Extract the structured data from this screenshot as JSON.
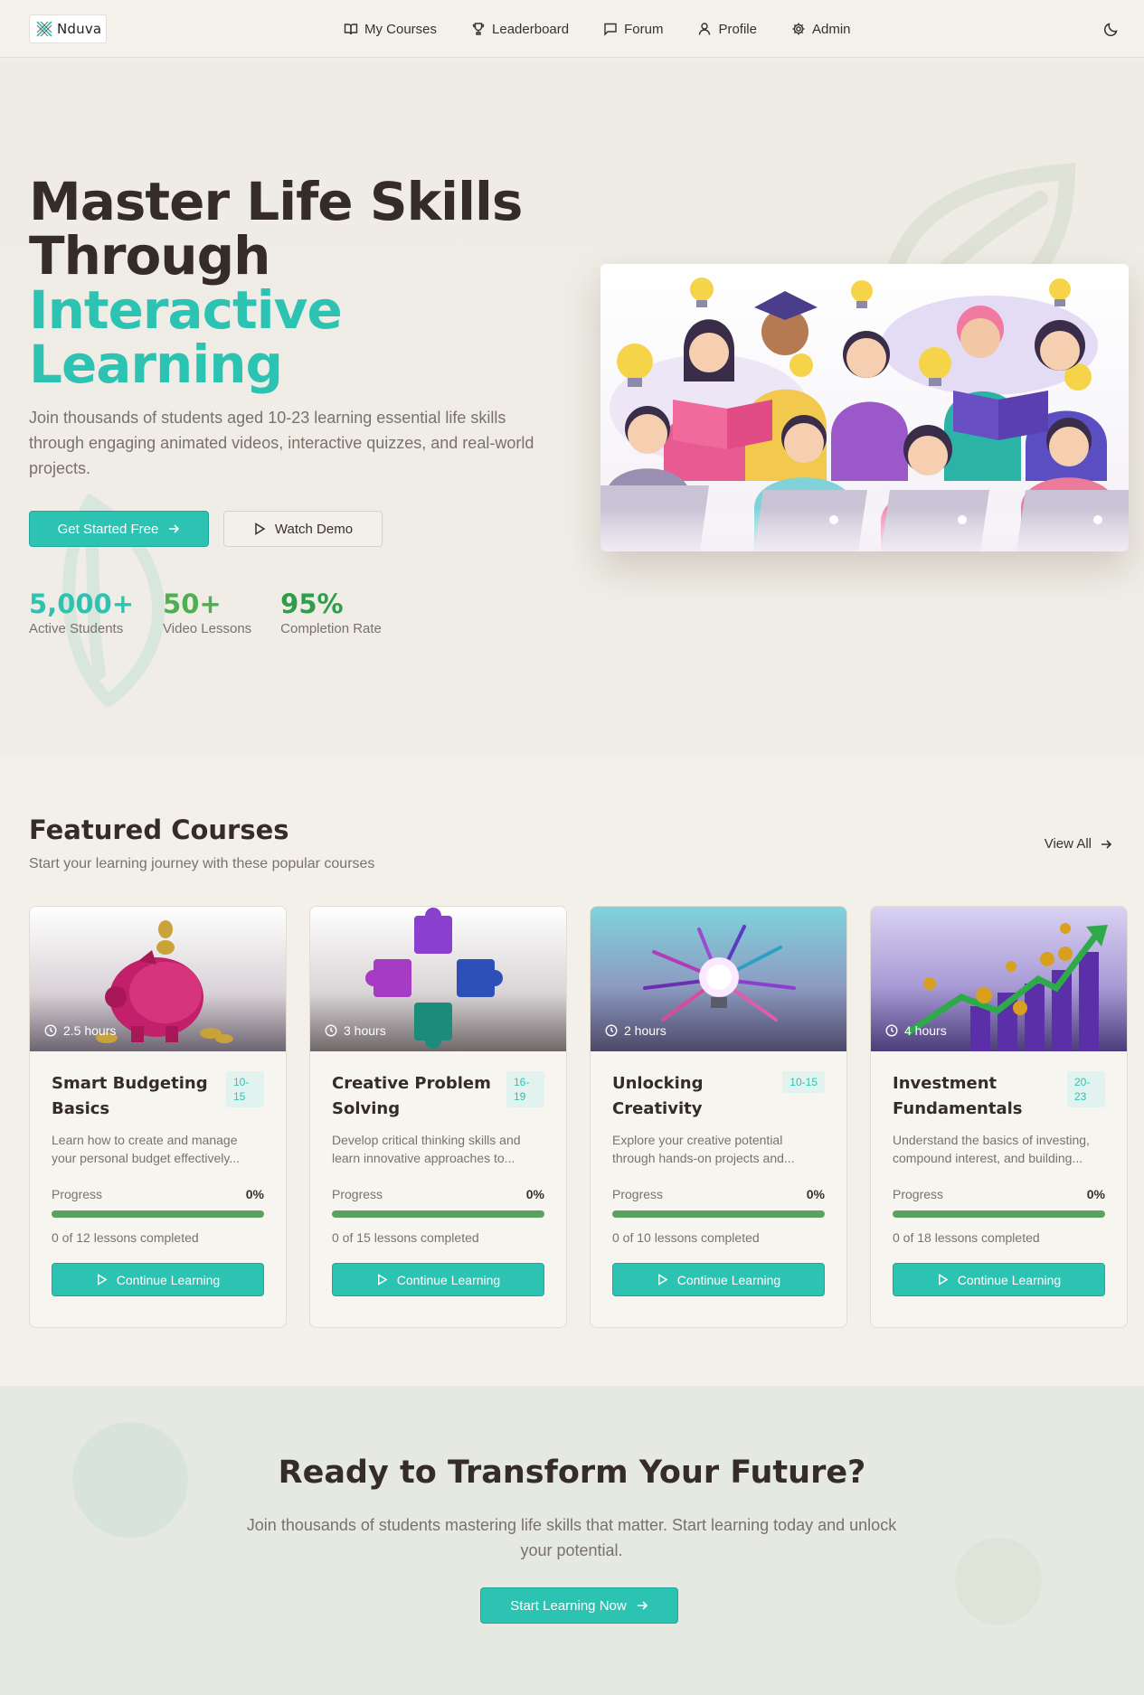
{
  "nav": {
    "logo_text": "Nduva",
    "links": [
      {
        "label": "My Courses",
        "icon": "book-icon"
      },
      {
        "label": "Leaderboard",
        "icon": "trophy-icon"
      },
      {
        "label": "Forum",
        "icon": "message-icon"
      },
      {
        "label": "Profile",
        "icon": "user-icon"
      },
      {
        "label": "Admin",
        "icon": "gear-icon"
      }
    ],
    "theme_icon": "moon-icon"
  },
  "hero": {
    "title_line1": "Master Life Skills",
    "title_line2": "Through",
    "title_accent1": "Interactive",
    "title_accent2": "Learning",
    "subtitle": "Join thousands of students aged 10-23 learning essential life skills through engaging animated videos, interactive quizzes, and real-world projects.",
    "primary_button": "Get Started Free",
    "secondary_button": "Watch Demo",
    "stats": [
      {
        "value": "5,000+",
        "label": "Active Students",
        "color": "#2cc3b3"
      },
      {
        "value": "50+",
        "label": "Video Lessons",
        "color": "#4caf50"
      },
      {
        "value": "95%",
        "label": "Completion Rate",
        "color": "#2e9e4a"
      }
    ]
  },
  "featured": {
    "title": "Featured Courses",
    "subtitle": "Start your learning journey with these popular courses",
    "view_all": "View All",
    "courses": [
      {
        "duration": "2.5 hours",
        "title": "Smart Budgeting Basics",
        "age": "10-15",
        "description": "Learn how to create and manage your personal budget effectively...",
        "progress_label": "Progress",
        "progress": "0%",
        "lessons": "0 of 12 lessons completed",
        "button": "Continue Learning"
      },
      {
        "duration": "3 hours",
        "title": "Creative Problem Solving",
        "age": "16-19",
        "description": "Develop critical thinking skills and learn innovative approaches to...",
        "progress_label": "Progress",
        "progress": "0%",
        "lessons": "0 of 15 lessons completed",
        "button": "Continue Learning"
      },
      {
        "duration": "2 hours",
        "title": "Unlocking Creativity",
        "age": "10-15",
        "description": "Explore your creative potential through hands-on projects and...",
        "progress_label": "Progress",
        "progress": "0%",
        "lessons": "0 of 10 lessons completed",
        "button": "Continue Learning"
      },
      {
        "duration": "4 hours",
        "title": "Investment Fundamentals",
        "age": "20-23",
        "description": "Understand the basics of investing, compound interest, and building...",
        "progress_label": "Progress",
        "progress": "0%",
        "lessons": "0 of 18 lessons completed",
        "button": "Continue Learning"
      }
    ]
  },
  "cta": {
    "title": "Ready to Transform Your Future?",
    "subtitle": "Join thousands of students mastering life skills that matter. Start learning today and unlock your potential.",
    "button": "Start Learning Now"
  },
  "colors": {
    "accent": "#2cc3b3",
    "progress": "#5ea15e",
    "text": "#352c27",
    "muted": "#7a716b",
    "background": "#f3f0ea"
  }
}
